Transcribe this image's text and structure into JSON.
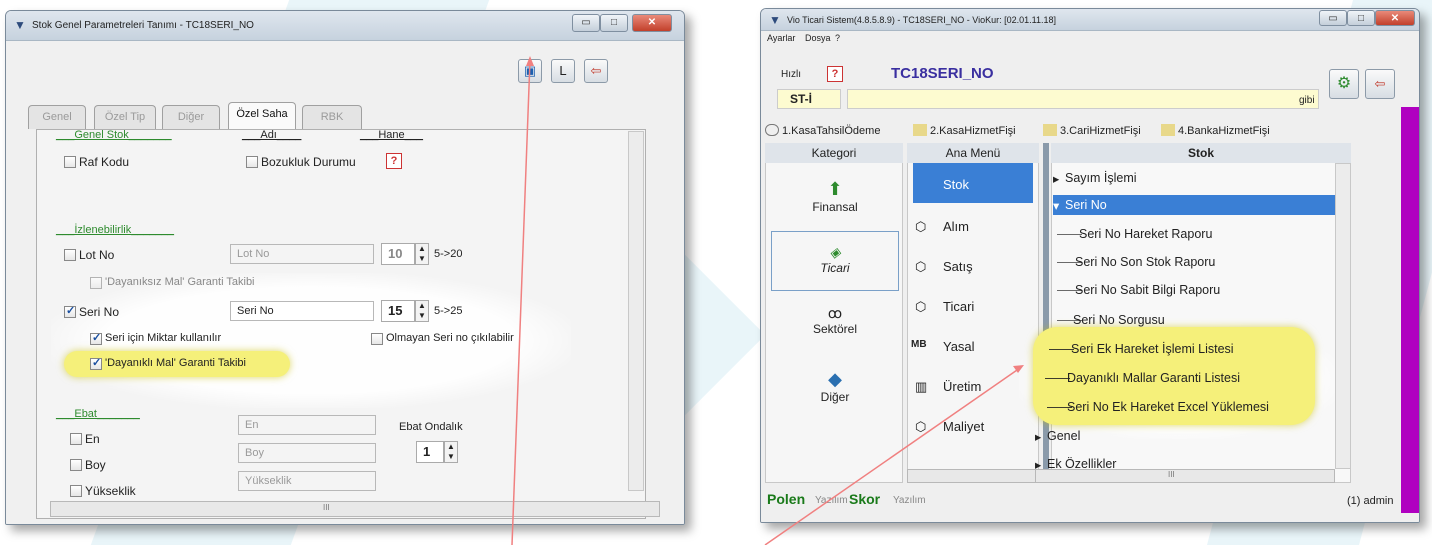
{
  "left_window": {
    "title": "Stok Genel Parametreleri Tanımı - TC18SERI_NO",
    "tabs": [
      "Genel",
      "Özel Tip",
      "Diğer",
      "Özel Saha",
      "RBK"
    ],
    "active_tab": "Özel Saha",
    "headers": {
      "genel_stok": "___Genel Stok_______",
      "adi": "___Adı____",
      "hane": "___Hane___",
      "izlenebilirlik": "___İzlenebilirlik_______",
      "ebat": "___Ebat_______"
    },
    "raf_kodu": "Raf Kodu",
    "bozukluk": "Bozukluk Durumu",
    "lot_no": {
      "label": "Lot No",
      "field": "Lot No",
      "value": "10",
      "range": "5->20"
    },
    "dayaniksiz": "'Dayanıksız Mal' Garanti Takibi",
    "seri_no": {
      "label": "Seri No",
      "field": "Seri No",
      "value": "15",
      "range": "5->25"
    },
    "seri_miktar": "Seri için Miktar kullanılır",
    "olmayan_seri": "Olmayan Seri no çıkılabilir",
    "dayanikli": "'Dayanıklı Mal' Garanti Takibi",
    "en": {
      "label": "En",
      "field": "En"
    },
    "boy": {
      "label": "Boy",
      "field": "Boy"
    },
    "yukseklik": {
      "label": "Yükseklik",
      "field": "Yükseklik"
    },
    "ebat_ondalik": {
      "label": "Ebat Ondalık",
      "value": "1"
    },
    "scroll_label": "III"
  },
  "right_window": {
    "title": "Vio Ticari Sistem(4.8.5.8.9) - TC18SERI_NO - VioKur: [02.01.11.18]",
    "menu": [
      "Ayarlar",
      "Dosya",
      "?"
    ],
    "hizli": "Hızlı",
    "company": "TC18SERI_NO",
    "st": "ST-İ",
    "gibi": "gibi",
    "shortcuts": [
      "1.KasaTahsilÖdeme",
      "2.KasaHizmetFişi",
      "3.CariHizmetFişi",
      "4.BankaHizmetFişi"
    ],
    "kategori_header": "Kategori",
    "anamenu_header": "Ana Menü",
    "stok_header": "Stok",
    "categories": [
      "Finansal",
      "Ticari",
      "Sektörel",
      "Diğer"
    ],
    "ana_menu": [
      "Stok",
      "Alım",
      "Satış",
      "Ticari",
      "Yasal",
      "Üretim",
      "Maliyet"
    ],
    "tree": {
      "sayim": "Sayım İşlemi",
      "seri_no": "Seri No",
      "children": [
        "Seri No Hareket Raporu",
        "Seri No Son Stok Raporu",
        "Seri No Sabit Bilgi Raporu",
        "Seri No Sorgusu",
        "Seri Ek Hareket İşlemi Listesi",
        "Dayanıklı Mallar Garanti Listesi",
        "Seri No Ek Hareket Excel Yüklemesi"
      ],
      "genel": "Genel",
      "ek": "Ek Özellikler"
    },
    "footer": {
      "polen": "Polen",
      "yazilim1": "Yazılım",
      "skor": "Skor",
      "yazilim2": "Yazılım",
      "user": "(1) admin"
    },
    "scroll_label": "III"
  },
  "colors": {
    "accent_blue": "#3a7fd5",
    "purple_bar": "#b000c0",
    "highlight": "#f5f07a",
    "arrow": "#f08080"
  }
}
